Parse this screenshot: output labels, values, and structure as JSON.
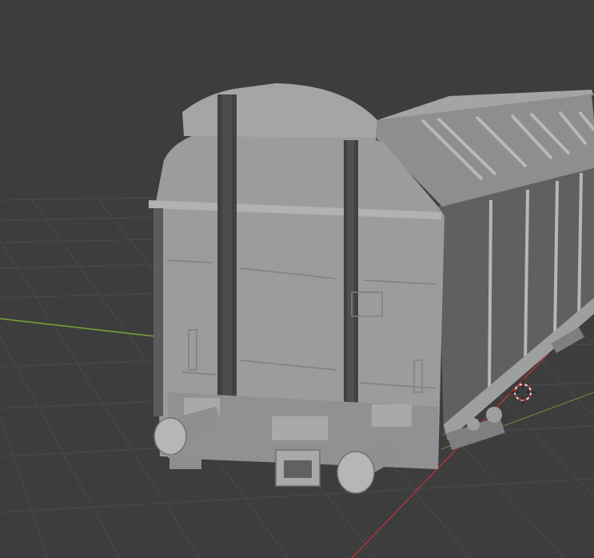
{
  "app": {
    "view": "3d-viewport",
    "shading": "solid"
  },
  "scene": {
    "object": "freight-wagon-model",
    "grid_visible": true,
    "x_axis_color": "#b0343a",
    "y_axis_color": "#7da33a",
    "background_color": "#3d3d3d",
    "grid_color": "#4a4a4a",
    "model_color": "#9a9c9d"
  }
}
